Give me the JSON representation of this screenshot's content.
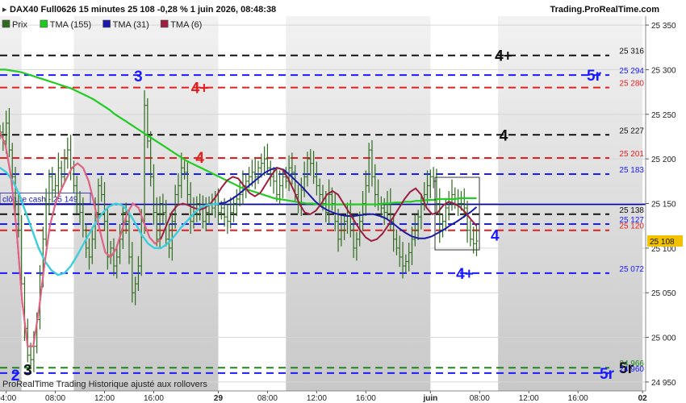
{
  "header": {
    "title": "DAX40 Full0626 15 minutes 25 108 -0,28 % 1 juin 2026, 08:48:38",
    "brand": "Trading.ProRealTime.com"
  },
  "legend": [
    {
      "label": "Prix",
      "color": "#2e6b1e"
    },
    {
      "label": "TMA (155)",
      "color": "#22c922"
    },
    {
      "label": "TMA (31)",
      "color": "#1a1aa8"
    },
    {
      "label": "TMA (6)",
      "color": "#9a2040"
    }
  ],
  "footer": {
    "note": "ProRealTime Trading  Historique ajusté aux rollovers"
  },
  "close_cash": {
    "label": "clôture cash -  25 149",
    "value": 25149,
    "color": "#0000aa"
  },
  "current_price": {
    "label": "25 108",
    "value": 25108
  },
  "colors": {
    "black": "#111111",
    "blue": "#1a1aff",
    "red": "#e02020",
    "green": "#1a8a1a"
  },
  "chart_data": {
    "type": "line",
    "ylim": [
      24940,
      25360
    ],
    "y_ticks": [
      {
        "value": 24950,
        "label": "24 950"
      },
      {
        "value": 25000,
        "label": "25 000"
      },
      {
        "value": 25050,
        "label": "25 050"
      },
      {
        "value": 25100,
        "label": "25 100"
      },
      {
        "value": 25150,
        "label": "25 150"
      },
      {
        "value": 25200,
        "label": "25 200"
      },
      {
        "value": 25250,
        "label": "25 250"
      },
      {
        "value": 25300,
        "label": "25 300"
      },
      {
        "value": 25350,
        "label": "25 350"
      }
    ],
    "x_ticks": [
      {
        "i": 2,
        "label": "04:00",
        "bold": false
      },
      {
        "i": 18,
        "label": "08:00",
        "bold": false
      },
      {
        "i": 34,
        "label": "12:00",
        "bold": false
      },
      {
        "i": 50,
        "label": "16:00",
        "bold": false
      },
      {
        "i": 71,
        "label": "29",
        "bold": true
      },
      {
        "i": 87,
        "label": "08:00",
        "bold": false
      },
      {
        "i": 103,
        "label": "12:00",
        "bold": false
      },
      {
        "i": 119,
        "label": "16:00",
        "bold": false
      },
      {
        "i": 140,
        "label": "juin",
        "bold": true
      },
      {
        "i": 156,
        "label": "08:00",
        "bold": false
      },
      {
        "i": 172,
        "label": "12:00",
        "bold": false
      },
      {
        "i": 188,
        "label": "16:00",
        "bold": false
      },
      {
        "i": 209,
        "label": "02",
        "bold": true
      }
    ],
    "levels": [
      {
        "value": 25316,
        "label": "25 316",
        "color": "black",
        "tag": "4+",
        "tag_x": 0.78
      },
      {
        "value": 25294,
        "label": "25 294",
        "color": "blue",
        "tag": "5r",
        "tag_x": 0.92
      },
      {
        "value": 25280,
        "label": "25 280",
        "color": "red",
        "tag": "",
        "tag_x": 0
      },
      {
        "value": 25227,
        "label": "25 227",
        "color": "black",
        "tag": "4",
        "tag_x": 0.78
      },
      {
        "value": 25201,
        "label": "25 201",
        "color": "red",
        "tag": "",
        "tag_x": 0
      },
      {
        "value": 25183,
        "label": "25 183",
        "color": "blue",
        "tag": "",
        "tag_x": 0
      },
      {
        "value": 25138,
        "label": "25 138",
        "color": "black",
        "tag": "",
        "tag_x": 0
      },
      {
        "value": 25127,
        "label": "25 127",
        "color": "blue",
        "tag": "",
        "tag_x": 0
      },
      {
        "value": 25120,
        "label": "25 120",
        "color": "red",
        "tag": "",
        "tag_x": 0
      },
      {
        "value": 25072,
        "label": "25 072",
        "color": "blue",
        "tag": "4+",
        "tag_x": 0.72
      },
      {
        "value": 24966,
        "label": "24 966",
        "color": "green",
        "tag": "5r",
        "tag_x": 0.97
      },
      {
        "value": 24960,
        "label": "24 960",
        "color": "blue",
        "tag": "5r",
        "tag_x": 0.94
      }
    ],
    "annotations": [
      {
        "text": "3",
        "color": "blue",
        "i": 45,
        "y": 25293
      },
      {
        "text": "4+",
        "color": "red",
        "i": 65,
        "y": 25280
      },
      {
        "text": "4",
        "color": "red",
        "i": 65,
        "y": 25202
      },
      {
        "text": "4",
        "color": "blue",
        "i": 161,
        "y": 25115
      },
      {
        "text": "2",
        "color": "blue",
        "i": 5,
        "y": 24958
      },
      {
        "text": "3",
        "color": "black",
        "i": 9,
        "y": 24964
      }
    ],
    "series": [
      {
        "name": "Prix",
        "style": "bars",
        "color": "#2e6b1e",
        "values": [
          25230,
          25220,
          25240,
          25210,
          25180,
          25150,
          25120,
          25060,
          25010,
          24980,
          24975,
          24990,
          25020,
          25070,
          25110,
          25150,
          25180,
          25165,
          25170,
          25190,
          25180,
          25200,
          25210,
          25190,
          25170,
          25150,
          25140,
          25120,
          25100,
          25090,
          25110,
          25140,
          25170,
          25160,
          25130,
          25090,
          25100,
          25080,
          25090,
          25110,
          25140,
          25130,
          25090,
          25050,
          25060,
          25080,
          25130,
          25260,
          25220,
          25180,
          25140,
          25110,
          25150,
          25140,
          25110,
          25100,
          25130,
          25160,
          25170,
          25190,
          25185,
          25160,
          25130,
          25140,
          25150,
          25145,
          25130,
          25140,
          25150,
          25145,
          25150,
          25140,
          25145,
          25135,
          25130,
          25140,
          25150,
          25155,
          25160,
          25170,
          25175,
          25180,
          25185,
          25180,
          25190,
          25195,
          25200,
          25190,
          25180,
          25175,
          25160,
          25170,
          25180,
          25175,
          25190,
          25185,
          25160,
          25150,
          25165,
          25180,
          25200,
          25195,
          25180,
          25170,
          25160,
          25150,
          25140,
          25160,
          25150,
          25130,
          25110,
          25120,
          25130,
          25140,
          25120,
          25100,
          25110,
          25130,
          25150,
          25170,
          25210,
          25180,
          25160,
          25150,
          25145,
          25140,
          25150,
          25130,
          25110,
          25100,
          25090,
          25080,
          25085,
          25095,
          25110,
          25120,
          25135,
          25150,
          25160,
          25170,
          25180,
          25175,
          25150,
          25120,
          25130,
          25145,
          25150,
          25160,
          25155,
          25150,
          25150,
          25145,
          25120,
          25110,
          25105,
          25108
        ]
      },
      {
        "name": "TMA (155)",
        "style": "line",
        "color": "#22cc22",
        "values": [
          25300,
          25300,
          25299,
          25298,
          25297,
          25295,
          25293,
          25291,
          25289,
          25287,
          25285,
          25283,
          25281,
          25279,
          25276,
          25273,
          25270,
          25267,
          25263,
          25259,
          25255,
          25250,
          25246,
          25242,
          25238,
          25234,
          25230,
          25226,
          25222,
          25218,
          25214,
          25210,
          25206,
          25202,
          25198,
          25195,
          25192,
          25189,
          25186,
          25183,
          25180,
          25177,
          25174,
          25171,
          25168,
          25166,
          25164,
          25162,
          25160,
          25158,
          25156,
          25155,
          25154,
          25153,
          25152,
          25151,
          25150,
          25150,
          25149,
          25149,
          25149,
          25149,
          25149,
          25149,
          25149,
          25149,
          25149,
          25149,
          25149,
          25149,
          25150,
          25150,
          25151,
          25151,
          25152,
          25152,
          25153,
          25153,
          25154,
          25154,
          25155,
          25155,
          25155,
          25155,
          25156,
          25156,
          25156,
          25156
        ]
      },
      {
        "name": "TMA (31)",
        "style": "line",
        "color": "#1a1aa8",
        "values": [
          25190,
          25185,
          25175,
          25160,
          25140,
          25120,
          25100,
          25085,
          25075,
          25070,
          25072,
          25080,
          25092,
          25105,
          25118,
          25130,
          25140,
          25147,
          25150,
          25148,
          25140,
          25128,
          25115,
          25105,
          25100,
          25100,
          25105,
          25113,
          25122,
          25130,
          25138,
          25145,
          25148,
          25149,
          25150,
          25151,
          25155,
          25160,
          25166,
          25172,
          25178,
          25184,
          25188,
          25190,
          25188,
          25182,
          25175,
          25168,
          25160,
          25152,
          25146,
          25142,
          25139,
          25137,
          25136,
          25136,
          25137,
          25138,
          25138,
          25136,
          25133,
          25128,
          25122,
          25117,
          25113,
          25111,
          25111,
          25113,
          25117,
          25121,
          25126,
          25130,
          25135,
          25140,
          25146
        ]
      },
      {
        "name": "TMA (6)",
        "style": "line",
        "color": "#9a2040",
        "values": [
          25230,
          25215,
          25180,
          25120,
          25040,
          24990,
          24990,
          25030,
          25080,
          25125,
          25150,
          25165,
          25178,
          25190,
          25195,
          25190,
          25175,
          25150,
          25120,
          25095,
          25090,
          25100,
          25120,
          25140,
          25150,
          25145,
          25128,
          25112,
          25105,
          25110,
          25125,
          25140,
          25148,
          25150,
          25148,
          25145,
          25143,
          25145,
          25150,
          25158,
          25168,
          25176,
          25180,
          25178,
          25170,
          25162,
          25158,
          25162,
          25172,
          25182,
          25190,
          25188,
          25178,
          25165,
          25150,
          25140,
          25138,
          25142,
          25150,
          25160,
          25164,
          25160,
          25150,
          25140,
          25130,
          25120,
          25112,
          25108,
          25110,
          25116,
          25125,
          25135,
          25145,
          25155,
          25163,
          25167,
          25160,
          25145,
          25138,
          25140,
          25148,
          25152,
          25150,
          25146,
          25140,
          25132,
          25125
        ]
      }
    ]
  }
}
